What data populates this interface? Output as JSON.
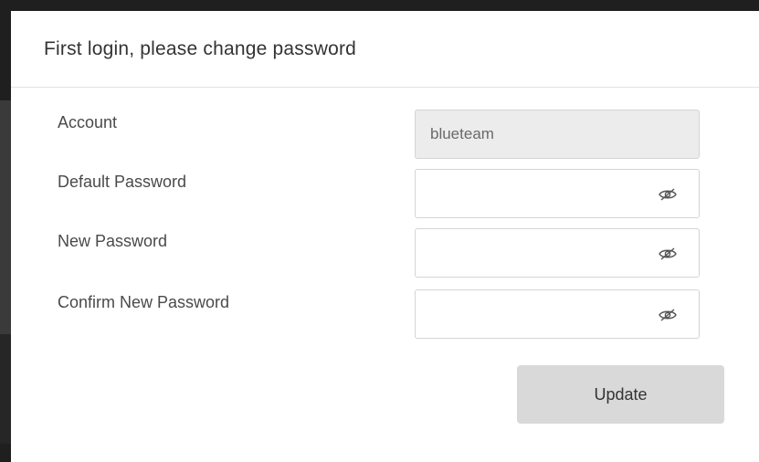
{
  "dialog": {
    "title": "First login, please change password"
  },
  "form": {
    "account": {
      "label": "Account",
      "value": "blueteam"
    },
    "default_password": {
      "label": "Default Password",
      "value": "",
      "toggle_icon": "eye-slash-icon"
    },
    "new_password": {
      "label": "New Password",
      "value": "",
      "toggle_icon": "eye-slash-icon"
    },
    "confirm_password": {
      "label": "Confirm New Password",
      "value": "",
      "toggle_icon": "eye-slash-icon"
    }
  },
  "actions": {
    "update_label": "Update"
  },
  "colors": {
    "readonly_field_bg": "#ececec",
    "button_bg": "#d9d9d9",
    "title_text": "#333333"
  }
}
